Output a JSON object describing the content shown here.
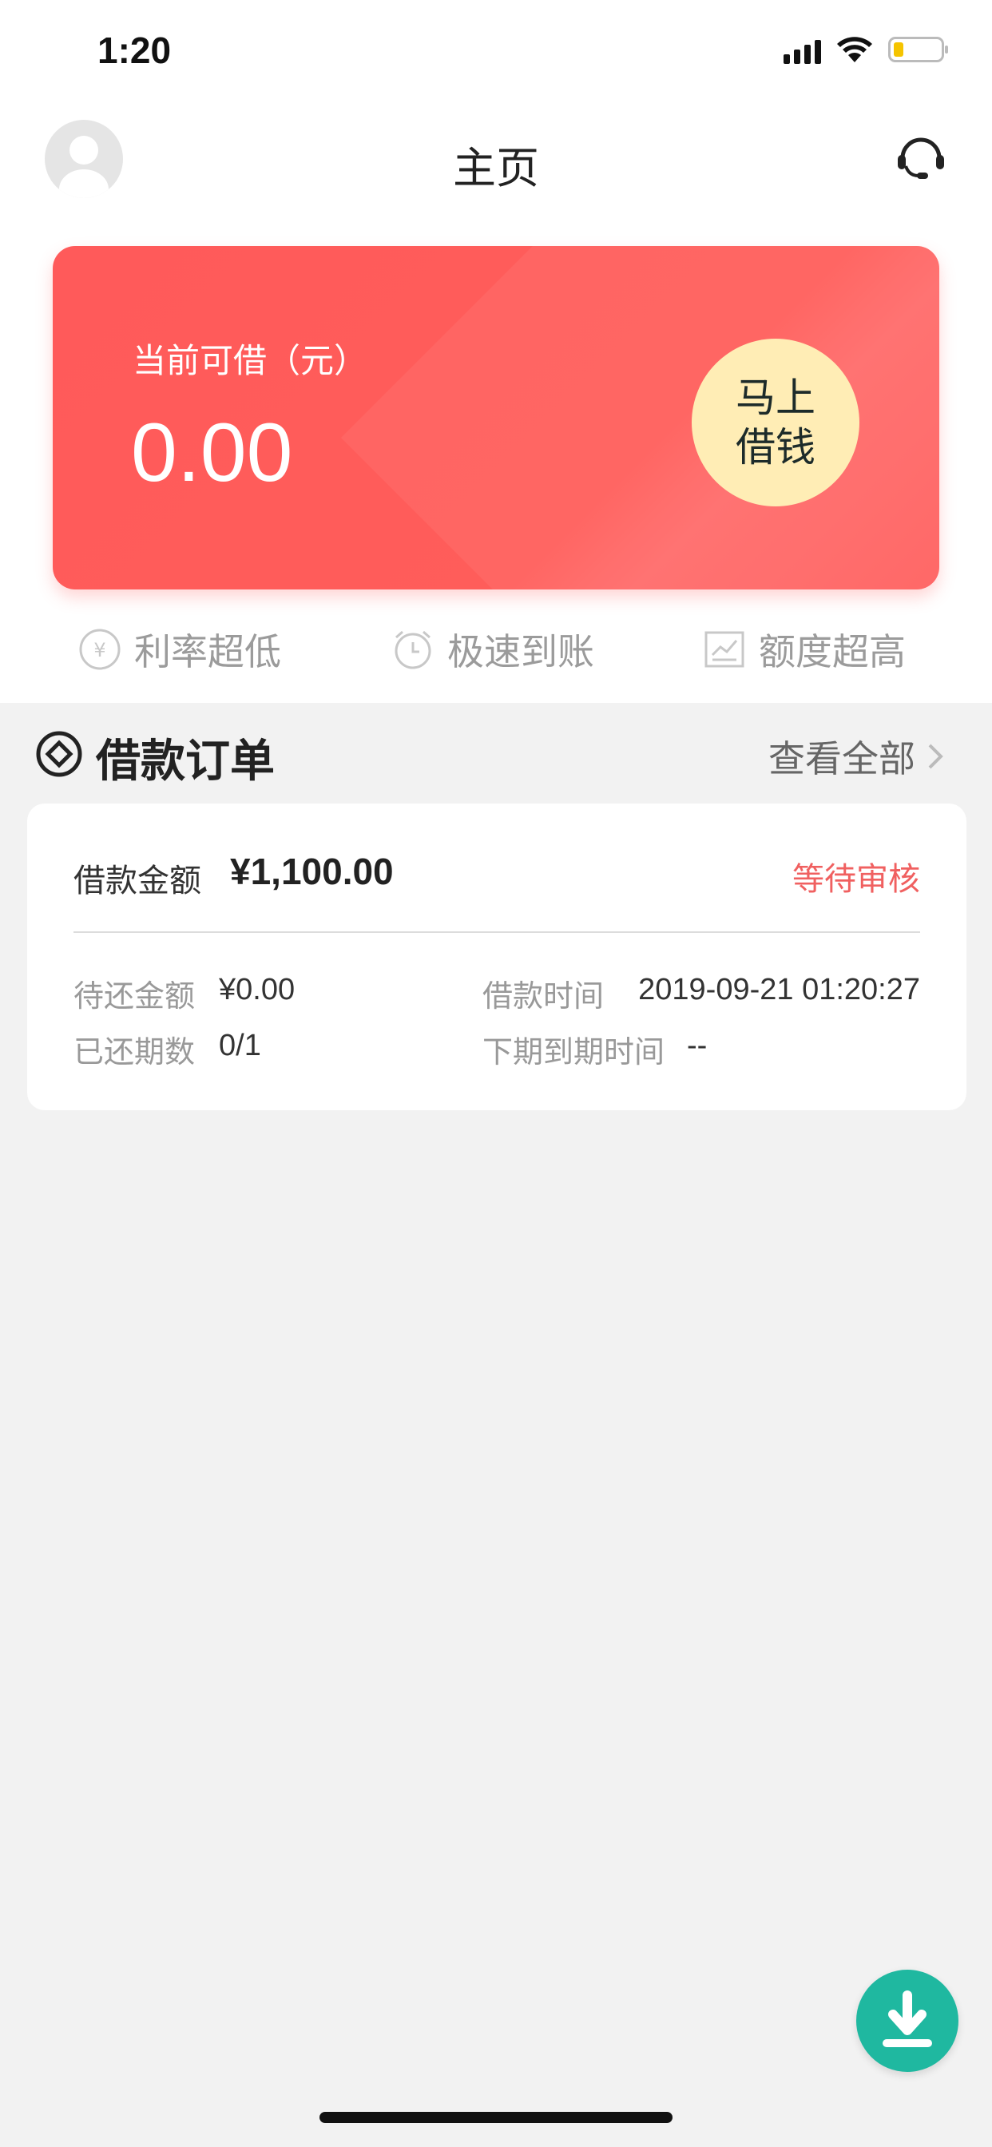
{
  "status_bar": {
    "time": "1:20"
  },
  "header": {
    "title": "主页"
  },
  "credit_card": {
    "label": "当前可借（元）",
    "amount": "0.00",
    "borrow_button_label": "马上借钱"
  },
  "features": [
    {
      "label": "利率超低",
      "icon": "yuan-circle-icon"
    },
    {
      "label": "极速到账",
      "icon": "alarm-clock-icon"
    },
    {
      "label": "额度超高",
      "icon": "chart-icon"
    }
  ],
  "orders": {
    "title": "借款订单",
    "view_all": "查看全部",
    "card": {
      "amount_label": "借款金额",
      "amount": "¥1,100.00",
      "status": "等待审核",
      "outstanding_label": "待还金额",
      "outstanding": "¥0.00",
      "borrow_time_label": "借款时间",
      "borrow_time": "2019-09-21 01:20:27",
      "periods_label": "已还期数",
      "periods": "0/1",
      "next_due_label": "下期到期时间",
      "next_due": "--"
    }
  },
  "colors": {
    "accent_red": "#ff5a5a",
    "button_yellow": "#ffedb5",
    "status_red": "#f06060",
    "fab_teal": "#1fb8a0"
  }
}
